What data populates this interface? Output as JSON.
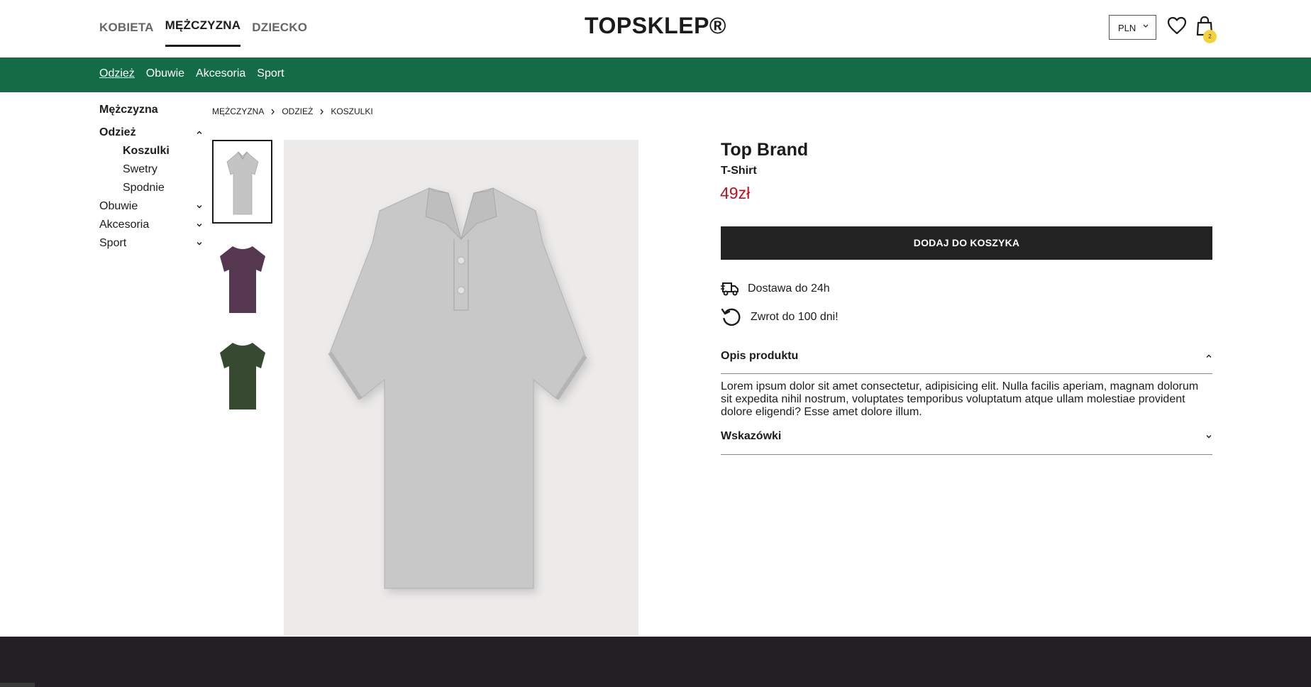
{
  "header": {
    "gender_tabs": [
      {
        "label": "KOBIETA",
        "active": false
      },
      {
        "label": "MĘŻCZYZNA",
        "active": true
      },
      {
        "label": "DZIECKO",
        "active": false
      }
    ],
    "logo": "TOPSKLEP®",
    "currency": "PLN",
    "cart_count": "2"
  },
  "category_bar": {
    "color": "#146c46",
    "items": [
      "Odzież",
      "Obuwie",
      "Akcesoria",
      "Sport"
    ]
  },
  "sidebar": {
    "title": "Mężczyzna",
    "items": [
      {
        "label": "Odzież",
        "expanded": true
      },
      {
        "label": "Koszulki"
      },
      {
        "label": "Swetry"
      },
      {
        "label": "Spodnie"
      },
      {
        "label": "Obuwie",
        "expanded": false
      },
      {
        "label": "Akcesoria",
        "expanded": false
      },
      {
        "label": "Sport",
        "expanded": false
      }
    ]
  },
  "breadcrumb": [
    "MĘŻCZYZNA",
    "ODZIEŻ",
    "KOSZULKI"
  ],
  "gallery": {
    "thumbnails": [
      {
        "name": "grey-polo-shirt",
        "color": "#c4c4c4"
      },
      {
        "name": "purple-t-shirt",
        "color": "#55384f"
      },
      {
        "name": "green-t-shirt",
        "color": "#354a31"
      }
    ],
    "main_image": "grey-polo-shirt"
  },
  "product": {
    "brand": "Top Brand",
    "name": "T-Shirt",
    "price": "49zł",
    "price_color": "#c0101e",
    "add_to_cart": "DODAJ DO KOSZYKA",
    "perks": [
      {
        "icon": "delivery-truck-icon",
        "label": "Dostawa do 24h"
      },
      {
        "icon": "return-arrow-icon",
        "label": "Zwrot do 100 dni!"
      }
    ],
    "accordions": [
      {
        "title": "Opis produktu",
        "expanded": true,
        "body": "Lorem ipsum dolor sit amet consectetur, adipisicing elit. Nulla facilis aperiam, magnam dolorum sit expedita nihil nostrum, voluptates temporibus voluptatum atque ullam molestiae provident dolore eligendi? Esse amet dolore illum."
      },
      {
        "title": "Wskazówki",
        "expanded": false
      }
    ]
  }
}
